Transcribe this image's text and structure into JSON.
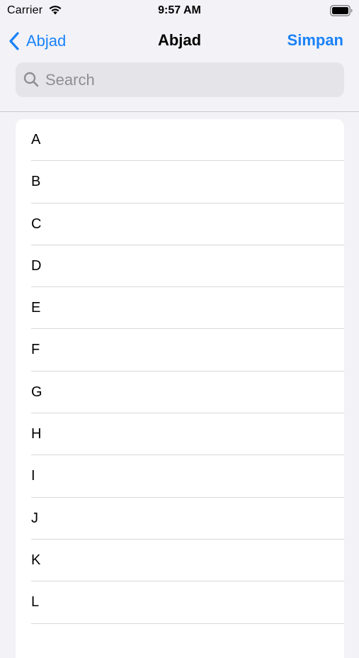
{
  "status_bar": {
    "carrier": "Carrier",
    "time": "9:57 AM",
    "wifi_icon": "wifi-icon",
    "battery_icon": "battery-icon"
  },
  "nav": {
    "back_label": "Abjad",
    "back_icon": "chevron-left-icon",
    "title": "Abjad",
    "save_label": "Simpan",
    "accent_color": "#1a82f7"
  },
  "search": {
    "placeholder": "Search",
    "value": "",
    "icon": "search-icon"
  },
  "list": {
    "items": [
      "A",
      "B",
      "C",
      "D",
      "E",
      "F",
      "G",
      "H",
      "I",
      "J",
      "K",
      "L",
      ""
    ]
  }
}
